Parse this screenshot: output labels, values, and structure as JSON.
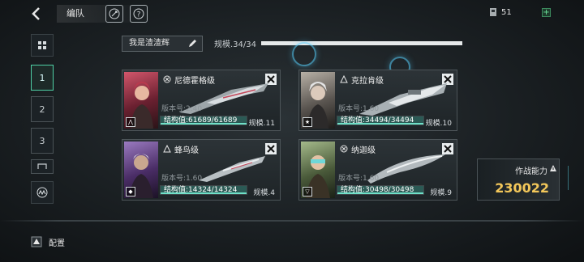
{
  "header": {
    "title": "编队",
    "currency": {
      "amount": "51",
      "plus": "+"
    }
  },
  "sidebar": {
    "tabs": [
      {
        "label": "1",
        "active": true
      },
      {
        "label": "2",
        "active": false
      },
      {
        "label": "3",
        "active": false
      }
    ]
  },
  "team": {
    "name": "我是渣渣辉",
    "scale_label": "规模.34/34",
    "scale_fill": 1.0
  },
  "ships": [
    {
      "name": "尼德霍格级",
      "version": "版本号:2.40",
      "hp": "结构值:61689/61689",
      "hp_fill": 1.0,
      "scale": "规模.11",
      "accent": "#c4475a"
    },
    {
      "name": "克拉肯级",
      "version": "版本号:1.60",
      "hp": "结构值:34494/34494",
      "hp_fill": 1.0,
      "scale": "规模.10",
      "accent": "#b9b2a8"
    },
    {
      "name": "蜂鸟级",
      "version": "版本号:1.60",
      "hp": "结构值:14324/14324",
      "hp_fill": 1.0,
      "scale": "规模.4",
      "accent": "#7a5aa0"
    },
    {
      "name": "纳迦级",
      "version": "版本号:1.60",
      "hp": "结构值:30498/30498",
      "hp_fill": 1.0,
      "scale": "规模.9",
      "accent": "#6fb3a8"
    }
  ],
  "power": {
    "label": "作战能力",
    "value": "230022"
  },
  "footer": {
    "config_label": "配置"
  },
  "colors": {
    "accent": "#4fd0a6",
    "power": "#f3c75a",
    "hp_fill": "#2b5a55"
  }
}
